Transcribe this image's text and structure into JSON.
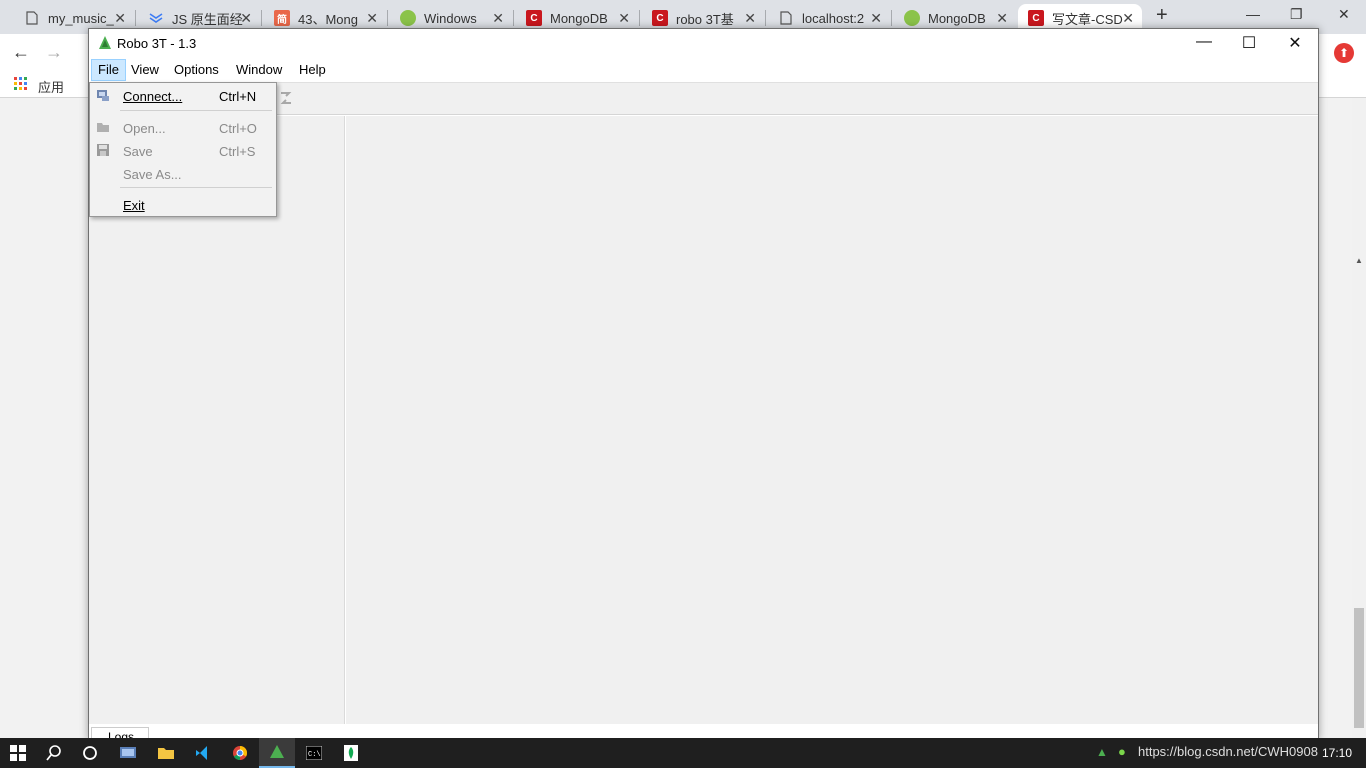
{
  "browser": {
    "tabs": [
      {
        "title": "my_music_",
        "icon": "document-icon",
        "color": "#ffffff"
      },
      {
        "title": "JS 原生面经",
        "icon": "layers-icon",
        "color": "#3d7cf5"
      },
      {
        "title": "43、Mong",
        "icon": "jianshu-icon",
        "color": "#e9684a"
      },
      {
        "title": "Windows",
        "icon": "bot-icon",
        "color": "#8bc34a"
      },
      {
        "title": "MongoDB",
        "icon": "csdn-icon",
        "color": "#c9171e"
      },
      {
        "title": "robo 3T基",
        "icon": "csdn-icon",
        "color": "#c9171e"
      },
      {
        "title": "localhost:2",
        "icon": "document-icon",
        "color": "#ffffff"
      },
      {
        "title": "MongoDB",
        "icon": "bot-icon",
        "color": "#8bc34a"
      },
      {
        "title": "写文章-CSD",
        "icon": "csdn-icon",
        "color": "#c9171e"
      }
    ],
    "bookmarks_label": "应用"
  },
  "robo": {
    "title": "Robo 3T - 1.3",
    "menus": [
      "File",
      "View",
      "Options",
      "Window",
      "Help"
    ],
    "file_menu": {
      "connect": {
        "label": "Connect...",
        "shortcut": "Ctrl+N"
      },
      "open": {
        "label": "Open...",
        "shortcut": "Ctrl+O"
      },
      "save": {
        "label": "Save",
        "shortcut": "Ctrl+S"
      },
      "save_as": {
        "label": "Save As..."
      },
      "exit": {
        "label": "Exit"
      }
    },
    "logs_tab": "Logs"
  },
  "taskbar": {
    "watermark": "https://blog.csdn.net/CWH0908",
    "clock": "17:10"
  },
  "colors": {
    "accent": "#cce8ff",
    "taskbar": "#1f1f1f",
    "robo_green": "#4caf50"
  }
}
